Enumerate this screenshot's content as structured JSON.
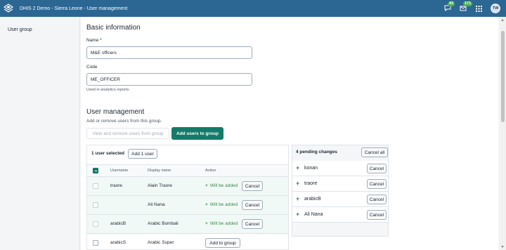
{
  "header": {
    "title": "DHIS 2 Demo - Sierra Leone - User management",
    "interpretations_count": "43",
    "messages_count": "171",
    "user_initials": "TW"
  },
  "sidebar": {
    "items": [
      {
        "label": "User group"
      }
    ]
  },
  "basic_info": {
    "title": "Basic information",
    "name_label": "Name *",
    "name_value": "M&E officers",
    "code_label": "Code",
    "code_value": "ME_OFFICER",
    "code_help": "Used in analytics reports."
  },
  "user_management": {
    "title": "User management",
    "description": "Add or remove users from this group.",
    "tab_view": "View and remove users from group",
    "tab_add": "Add users to group",
    "selected_text": "1 user selected",
    "add_button": "Add 1 user",
    "columns": [
      "Username",
      "Display name",
      "Action"
    ],
    "rows": [
      {
        "username": "traore",
        "display_name": "Alain Traore",
        "status": "Will be added",
        "action": "Cancel"
      },
      {
        "username": "",
        "display_name": "Ali Nana",
        "status": "Will be added",
        "action": "Cancel"
      },
      {
        "username": "arabicB",
        "display_name": "Arabic Bombali",
        "status": "Will be added",
        "action": "Cancel"
      },
      {
        "username": "arabicS",
        "display_name": "Arabic Super",
        "status": "",
        "action": "Add to group"
      }
    ]
  },
  "pending": {
    "title": "4 pending changes",
    "cancel_all": "Cancel all",
    "items": [
      {
        "name": "konan",
        "action": "Cancel"
      },
      {
        "name": "traore",
        "action": "Cancel"
      },
      {
        "name": "arabicB",
        "action": "Cancel"
      },
      {
        "name": "Ali Nana",
        "action": "Cancel"
      }
    ]
  },
  "colors": {
    "header": "#2c6693",
    "primary": "#147a69",
    "added_text": "#3b8b4a",
    "added_row": "#f1f9f6"
  },
  "icons": [
    "dhis2-logo-icon",
    "interpretations-icon",
    "messages-icon",
    "apps-grid-icon",
    "plus-icon",
    "checkbox-icon"
  ]
}
